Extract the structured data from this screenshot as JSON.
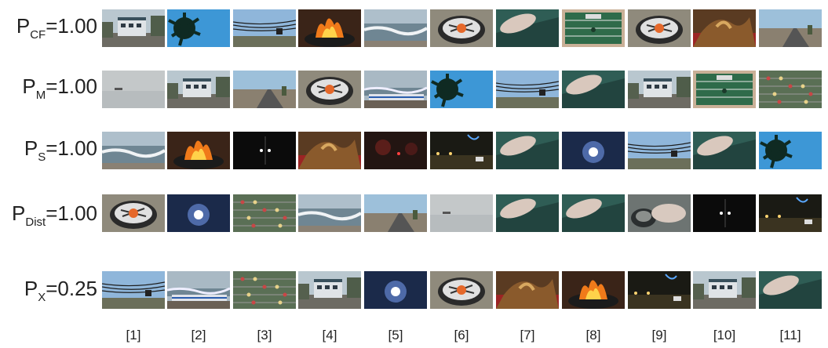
{
  "rows": [
    {
      "base": "P",
      "sub": "CF",
      "value": "=1.00",
      "thumbs": [
        "house",
        "palm",
        "wires",
        "fire",
        "sea",
        "grill",
        "hand",
        "foosball",
        "grill",
        "fire2",
        "road"
      ]
    },
    {
      "base": "P",
      "sub": "M",
      "value": "=1.00",
      "thumbs": [
        "fog",
        "house",
        "road",
        "grill",
        "train",
        "palm",
        "wires",
        "hand",
        "house",
        "foosball",
        "foosball2"
      ]
    },
    {
      "base": "P",
      "sub": "S",
      "value": "=1.00",
      "thumbs": [
        "sea",
        "fire",
        "night2",
        "fire2",
        "nightred",
        "nightroad",
        "hand",
        "moon",
        "wires",
        "hand",
        "palm"
      ]
    },
    {
      "base": "P",
      "sub": "Dist",
      "value": "=1.00",
      "thumbs": [
        "grill",
        "moon",
        "foosball2",
        "sea",
        "road",
        "fog",
        "hand",
        "hand",
        "cup",
        "night2",
        "nightroad"
      ]
    },
    {
      "base": "P",
      "sub": "X",
      "value": "=0.25",
      "thumbs": [
        "wires",
        "train",
        "foosball2",
        "house",
        "moon",
        "grill",
        "fire2",
        "fire",
        "nightroad",
        "house",
        "hand"
      ]
    }
  ],
  "columns": [
    "[1]",
    "[2]",
    "[3]",
    "[4]",
    "[5]",
    "[6]",
    "[7]",
    "[8]",
    "[9]",
    "[10]",
    "[11]"
  ]
}
